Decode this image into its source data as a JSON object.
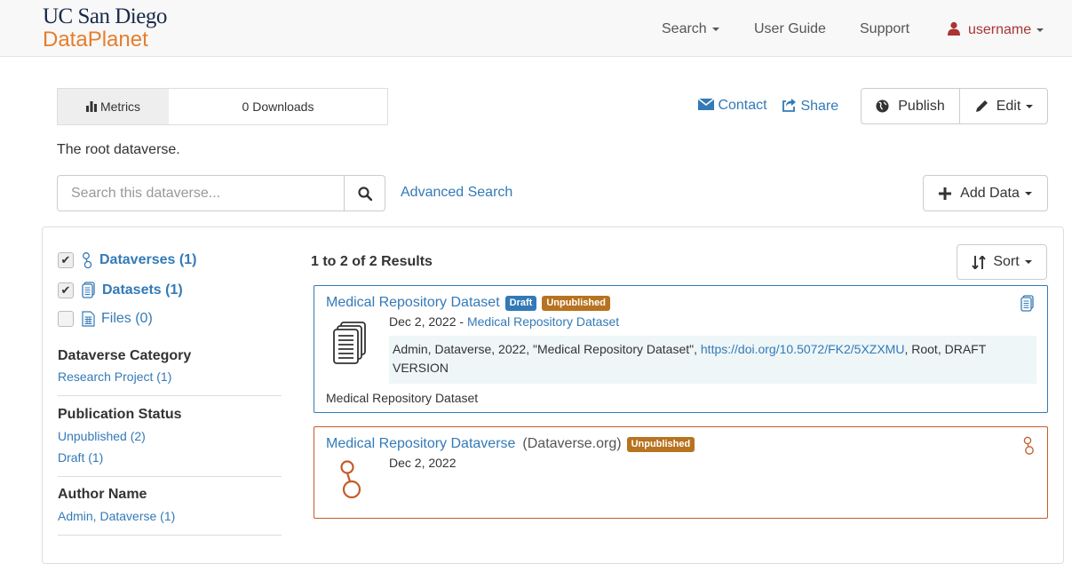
{
  "navbar": {
    "brand_top": "UC San Diego",
    "brand_bottom": "DataPlanet",
    "search_label": "Search",
    "user_guide_label": "User Guide",
    "support_label": "Support",
    "username": "username"
  },
  "metrics": {
    "label": "Metrics",
    "downloads": "0 Downloads"
  },
  "actions": {
    "contact_label": "Contact",
    "share_label": "Share",
    "publish_label": "Publish",
    "edit_label": "Edit",
    "add_data_label": "Add Data"
  },
  "dataverse_description": "The root dataverse.",
  "search": {
    "placeholder": "Search this dataverse...",
    "advanced_label": "Advanced Search"
  },
  "facets": {
    "type_filters": [
      {
        "label": "Dataverses (1)",
        "checked": true,
        "icon": "dataverse-icon"
      },
      {
        "label": "Datasets (1)",
        "checked": true,
        "icon": "dataset-icon"
      },
      {
        "label": "Files (0)",
        "checked": false,
        "icon": "file-icon"
      }
    ],
    "groups": [
      {
        "title": "Dataverse Category",
        "items": [
          "Research Project (1)"
        ]
      },
      {
        "title": "Publication Status",
        "items": [
          "Unpublished (2)",
          "Draft (1)"
        ]
      },
      {
        "title": "Author Name",
        "items": [
          "Admin, Dataverse (1)"
        ]
      }
    ]
  },
  "results": {
    "count_text": "1 to 2 of 2 Results",
    "sort_label": "Sort",
    "items": [
      {
        "title": "Medical Repository Dataset",
        "badges": [
          "Draft",
          "Unpublished"
        ],
        "date": "Dec 2, 2022",
        "separator": " - ",
        "parent": "Medical Repository Dataset",
        "citation_prefix": "Admin, Dataverse, 2022, \"Medical Repository Dataset\", ",
        "citation_doi": "https://doi.org/10.5072/FK2/5XZXMU",
        "citation_suffix": ", Root, DRAFT VERSION",
        "summary": "Medical Repository Dataset"
      },
      {
        "title": "Medical Repository Dataverse",
        "affiliation": "(Dataverse.org)",
        "badges": [
          "Unpublished"
        ],
        "date": "Dec 2, 2022"
      }
    ]
  },
  "colors": {
    "link": "#337ab7",
    "dataset_border": "#337ab7",
    "dataverse_border": "#c55b28",
    "unpublished_badge": "#b7731f",
    "brand_orange": "#e57e2c"
  }
}
